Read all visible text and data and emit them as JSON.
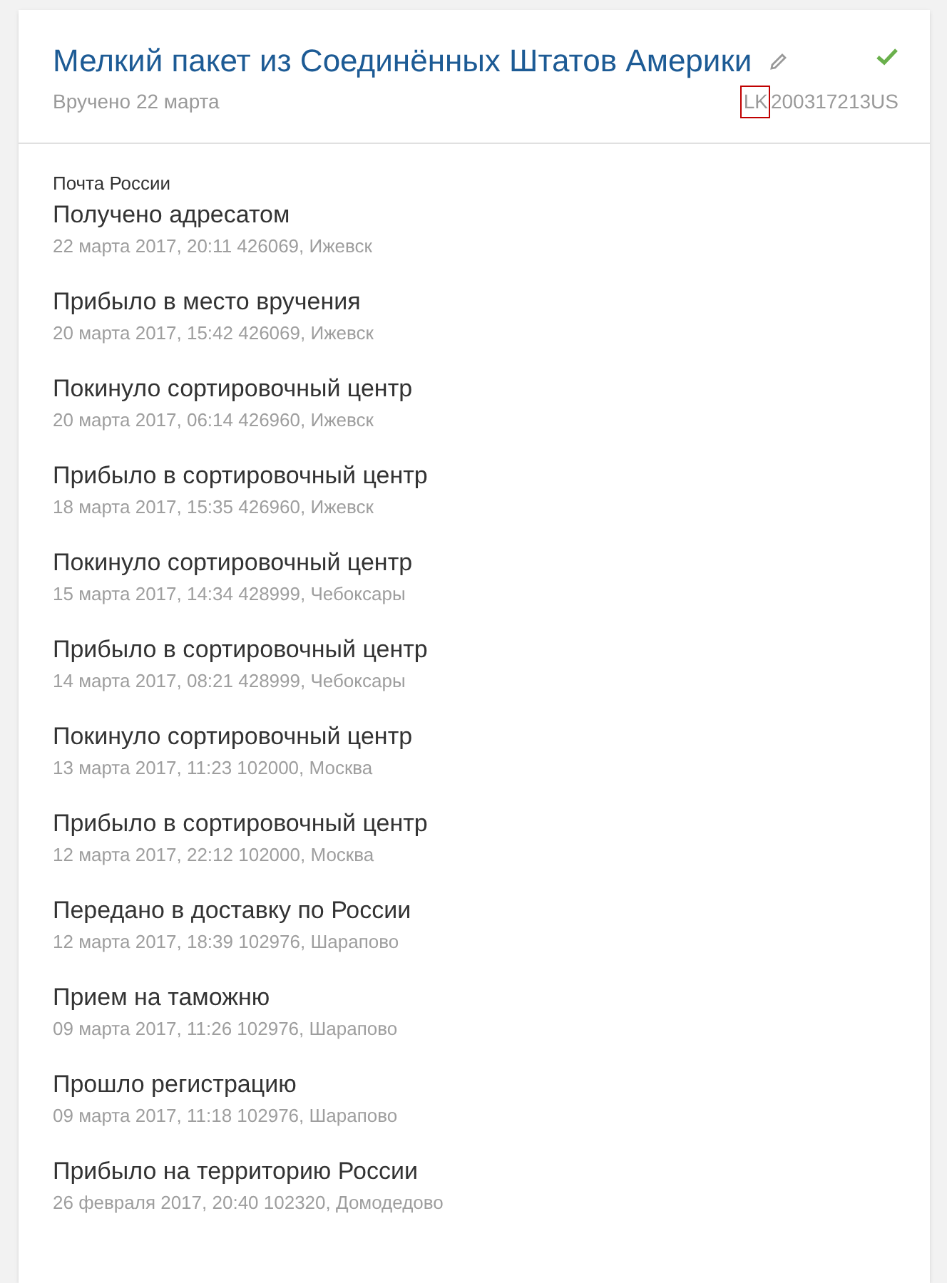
{
  "header": {
    "title": "Мелкий пакет из Соединённых Штатов Америки",
    "status": "Вручено 22 марта",
    "delivered": true,
    "tracking": {
      "prefix": "LK",
      "prefix_highlighted": true,
      "rest": "200317213US"
    }
  },
  "carrier": "Почта России",
  "events": [
    {
      "title": "Получено адресатом",
      "details": "22 марта 2017, 20:11 426069, Ижевск"
    },
    {
      "title": "Прибыло в место вручения",
      "details": "20 марта 2017, 15:42 426069, Ижевск"
    },
    {
      "title": "Покинуло сортировочный центр",
      "details": "20 марта 2017, 06:14 426960, Ижевск"
    },
    {
      "title": "Прибыло в сортировочный центр",
      "details": "18 марта 2017, 15:35 426960, Ижевск"
    },
    {
      "title": "Покинуло сортировочный центр",
      "details": "15 марта 2017, 14:34 428999, Чебоксары"
    },
    {
      "title": "Прибыло в сортировочный центр",
      "details": "14 марта 2017, 08:21 428999, Чебоксары"
    },
    {
      "title": "Покинуло сортировочный центр",
      "details": "13 марта 2017, 11:23 102000, Москва"
    },
    {
      "title": "Прибыло в сортировочный центр",
      "details": "12 марта 2017, 22:12 102000, Москва"
    },
    {
      "title": "Передано в доставку по России",
      "details": "12 марта 2017, 18:39 102976, Шарапово"
    },
    {
      "title": "Прием на таможню",
      "details": "09 марта 2017, 11:26 102976, Шарапово"
    },
    {
      "title": "Прошло регистрацию",
      "details": "09 марта 2017, 11:18 102976, Шарапово"
    },
    {
      "title": "Прибыло на территорию России",
      "details": "26 февраля 2017, 20:40 102320, Домодедово"
    }
  ]
}
